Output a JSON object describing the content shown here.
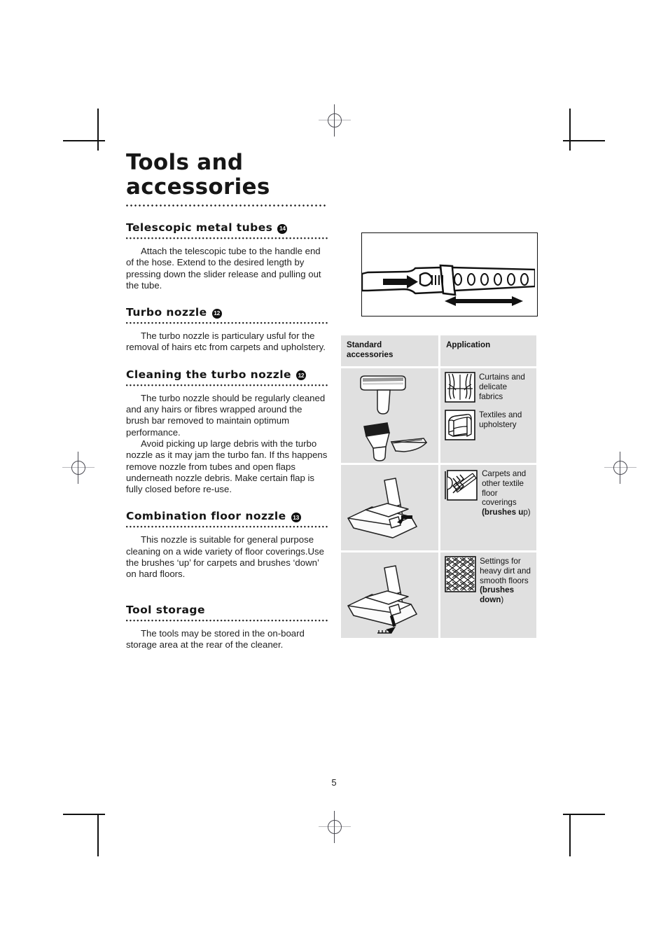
{
  "page": {
    "title": "Tools and\naccessories",
    "number": "5"
  },
  "sections": [
    {
      "heading": "Telescopic metal tubes",
      "badge": "14",
      "paragraphs": [
        "Attach the telescopic tube to the handle end of the hose. Extend to the desired length by pressing down the slider release and pulling out the tube."
      ]
    },
    {
      "heading": "Turbo nozzle",
      "badge": "12",
      "paragraphs": [
        "The turbo nozzle is particulary usful for the removal of hairs etc from carpets and upholstery."
      ]
    },
    {
      "heading": "Cleaning the turbo nozzle",
      "badge": "12",
      "paragraphs": [
        "The turbo nozzle should be regularly cleaned and any hairs or fibres wrapped around the brush bar removed to maintain optimum performance.",
        "Avoid picking up large debris with the turbo nozzle as it may jam the turbo fan. If ths happens remove nozzle from tubes and open flaps underneath nozzle debris. Make certain flap is fully closed before re-use."
      ]
    },
    {
      "heading": "Combination floor nozzle",
      "badge": "13",
      "paragraphs": [
        "This nozzle is suitable for general purpose cleaning on a wide variety of floor coverings.Use the brushes ‘up’ for carpets and brushes ‘down’ on hard floors."
      ]
    },
    {
      "heading": "Tool storage",
      "badge": "",
      "paragraphs": [
        "The tools may be stored in the on-board storage area  at the rear of the cleaner."
      ]
    }
  ],
  "illustration": {
    "name": "telescopic-tube-diagram",
    "caption": ""
  },
  "table": {
    "headers": {
      "accessories": "Standard\naccessories",
      "application": "Application"
    },
    "rows": [
      {
        "tools_icon": "upholstery-nozzle-dusting-brush-crevice-tool",
        "applications": [
          {
            "icon": "curtains-icon",
            "text": "Curtains and\ndelicate\nfabrics",
            "bold_prefix": "",
            "bold_suffix": ""
          },
          {
            "icon": "armchair-icon",
            "text": "Textiles and\nupholstery",
            "bold_prefix": "",
            "bold_suffix": ""
          }
        ]
      },
      {
        "tools_icon": "combination-floor-nozzle-brushes-up",
        "applications": [
          {
            "icon": "carpet-icon",
            "text": "Carpets and\nother textile\nfloor coverings\n",
            "bold_prefix": "(brushes u",
            "bold_suffix": "p)"
          }
        ]
      },
      {
        "tools_icon": "combination-floor-nozzle-brushes-down",
        "applications": [
          {
            "icon": "parquet-floor-icon",
            "text": "Settings for\nheavy dirt and\nsmooth floors\n",
            "bold_prefix": "(brushes\ndown",
            "bold_suffix": ")"
          }
        ]
      }
    ]
  },
  "colors": {
    "table_cell_bg": "#e0e0e0",
    "ink": "#1a1a1a",
    "badge_bg": "#111111"
  }
}
